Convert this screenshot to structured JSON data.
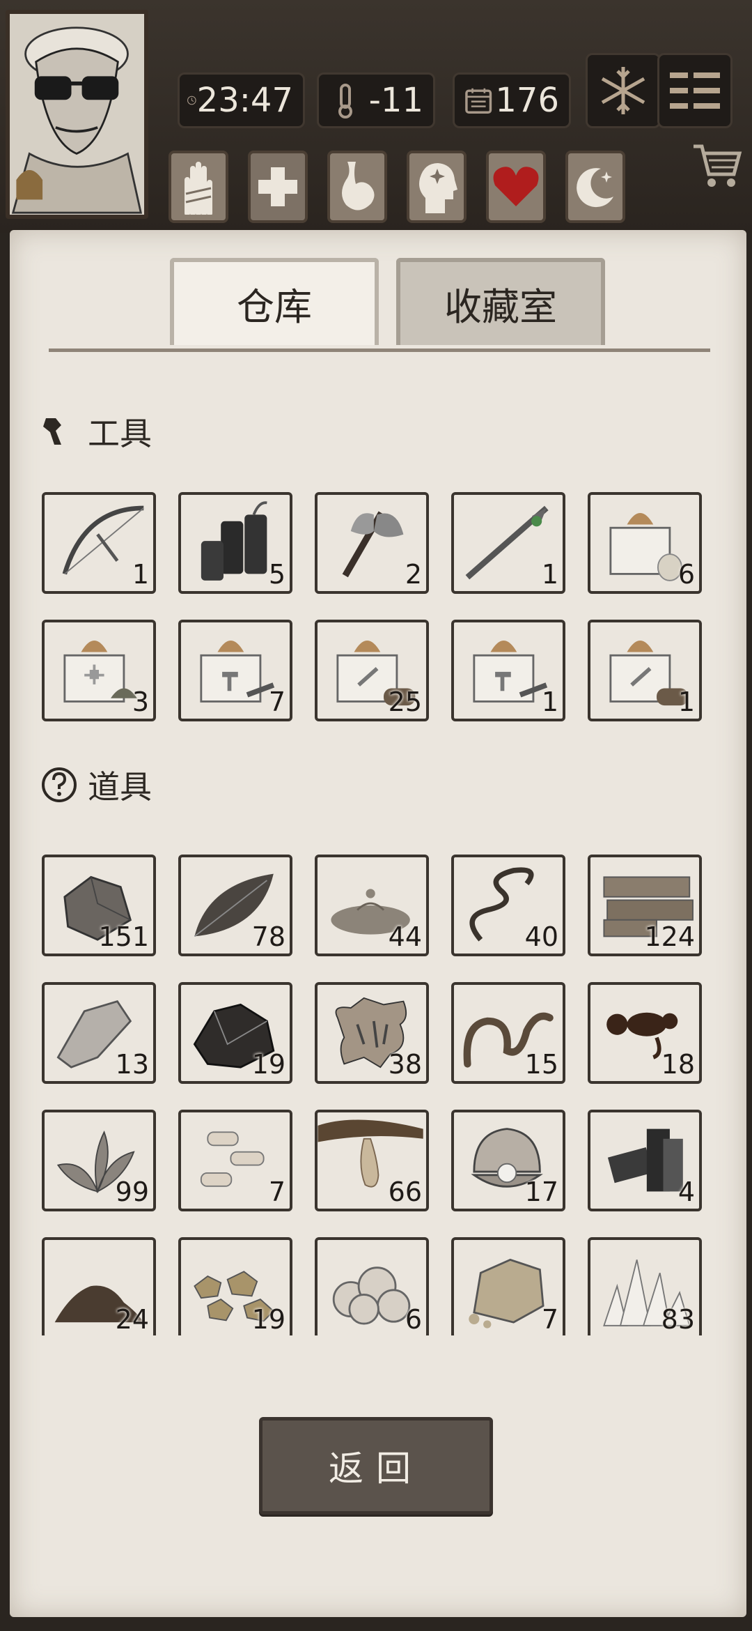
{
  "status_bar": {
    "time": "23:47",
    "temperature": "-11",
    "day": "176",
    "time_icon": "clock-icon",
    "temp_icon": "thermometer-icon",
    "day_icon": "calendar-icon"
  },
  "status_effects": [
    "bandaged-hand-icon",
    "health-cross-icon",
    "stomach-icon",
    "mind-icon",
    "heart-icon",
    "sleep-moon-icon"
  ],
  "tabs": {
    "warehouse": "仓库",
    "collection": "收藏室"
  },
  "sections": {
    "tools": {
      "title": "工具",
      "icon": "wrench-icon"
    },
    "props": {
      "title": "道具",
      "icon": "question-icon"
    }
  },
  "tools": [
    {
      "name": "bow",
      "count": "1"
    },
    {
      "name": "dynamite",
      "count": "5"
    },
    {
      "name": "axe",
      "count": "2"
    },
    {
      "name": "spear",
      "count": "1"
    },
    {
      "name": "food-box",
      "count": "6"
    },
    {
      "name": "medical-box",
      "count": "3"
    },
    {
      "name": "tool-box",
      "count": "7"
    },
    {
      "name": "wood-box",
      "count": "25"
    },
    {
      "name": "tool-box",
      "count": "1"
    },
    {
      "name": "wood-box",
      "count": "1"
    }
  ],
  "props": [
    {
      "name": "stone",
      "count": "151"
    },
    {
      "name": "leaf",
      "count": "78"
    },
    {
      "name": "water-puddle",
      "count": "44"
    },
    {
      "name": "vine",
      "count": "40"
    },
    {
      "name": "planks",
      "count": "124"
    },
    {
      "name": "flint",
      "count": "13"
    },
    {
      "name": "coal-ore",
      "count": "19"
    },
    {
      "name": "animal-hide",
      "count": "38"
    },
    {
      "name": "worm",
      "count": "15"
    },
    {
      "name": "oil",
      "count": "18"
    },
    {
      "name": "herb",
      "count": "99"
    },
    {
      "name": "bone-pieces",
      "count": "7"
    },
    {
      "name": "resin",
      "count": "66"
    },
    {
      "name": "pearl-shell",
      "count": "17"
    },
    {
      "name": "iron-scrap",
      "count": "4"
    },
    {
      "name": "soil",
      "count": "24"
    },
    {
      "name": "gold-nuggets",
      "count": "19"
    },
    {
      "name": "wool",
      "count": "6"
    },
    {
      "name": "sandstone",
      "count": "7"
    },
    {
      "name": "quartz",
      "count": "83"
    }
  ],
  "return_label": "返回"
}
